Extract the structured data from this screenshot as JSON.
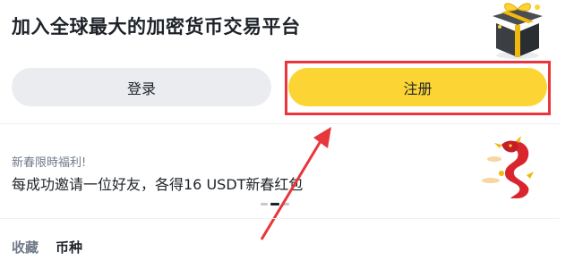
{
  "header": {
    "headline": "加入全球最大的加密货币交易平台",
    "gift_icon": "gift-box-icon"
  },
  "auth": {
    "login_label": "登录",
    "register_label": "注册"
  },
  "promo": {
    "tag": "新春限時福利!",
    "text": "每成功邀请一位好友，各得16 USDT新春红包",
    "image_icon": "dragon-icon"
  },
  "carousel": {
    "slide_count": 3,
    "active_index": 1
  },
  "tabs": {
    "favorites_label": "收藏",
    "coins_label": "币种"
  },
  "colors": {
    "accent": "#fcd535",
    "annotation": "#e8363a",
    "secondary_button": "#eaecef"
  }
}
